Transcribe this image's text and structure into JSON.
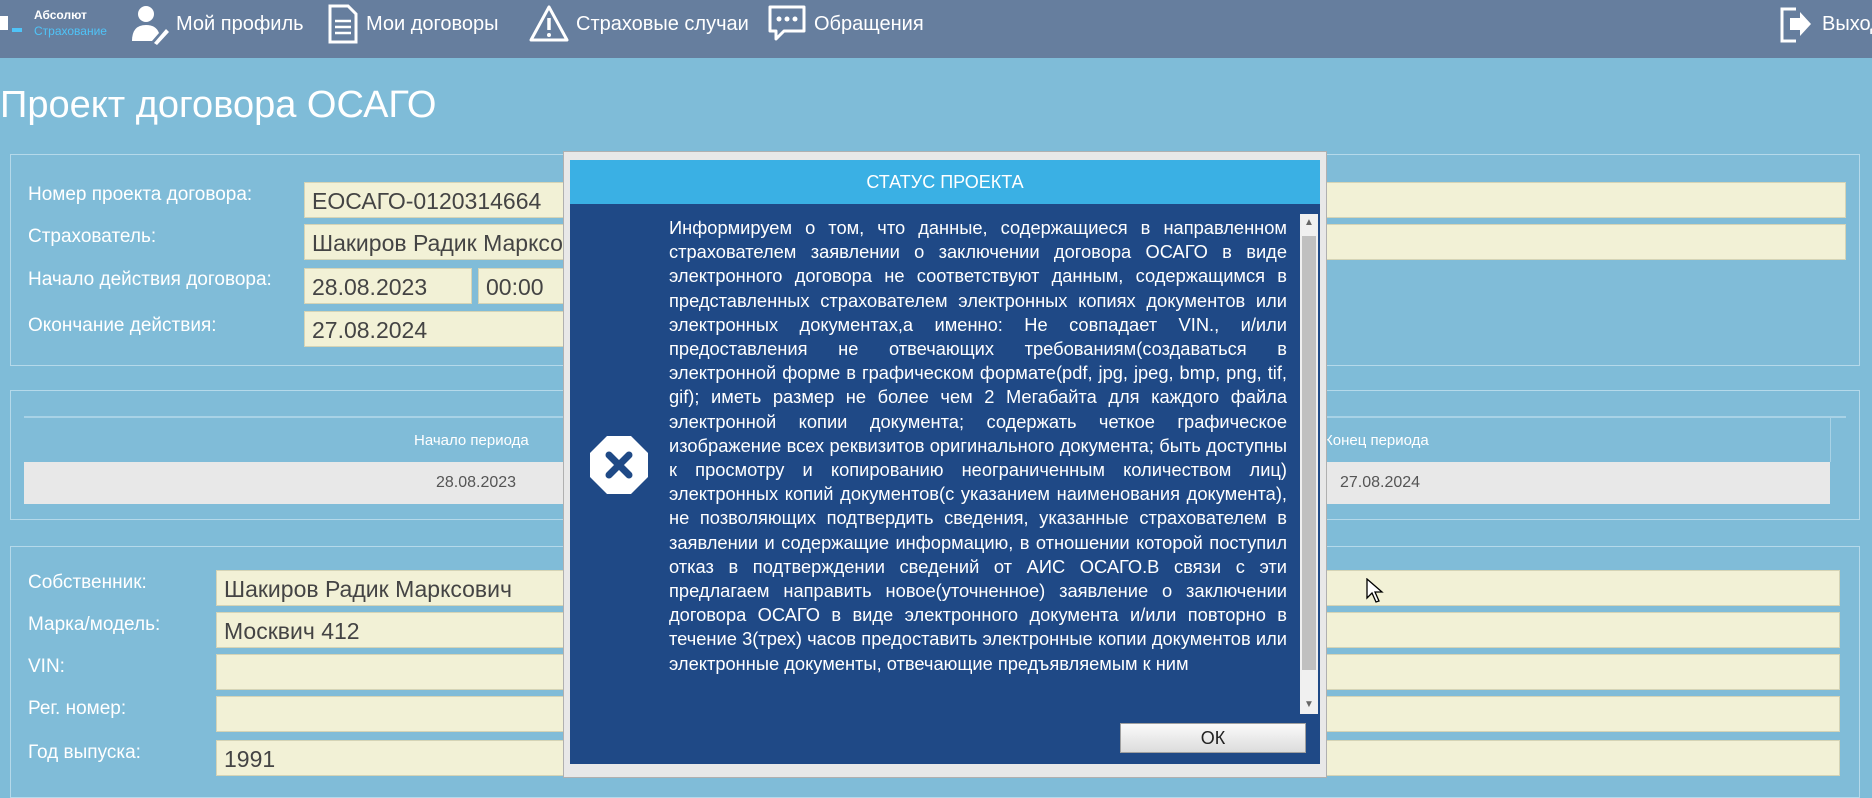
{
  "nav": {
    "logo_line1": "Абсолют",
    "logo_line2": "Страхование",
    "profile": "Мой профиль",
    "contracts": "Мои договоры",
    "insured_events": "Страховые случаи",
    "appeals": "Обращения",
    "exit": "Выход"
  },
  "page_title": "Проект договора ОСАГО",
  "contract": {
    "number_label": "Номер проекта договора:",
    "number_value": "ЕОСАГО-0120314664",
    "insurer_label": "Страхователь:",
    "insurer_value": "Шакиров Радик Марксович",
    "start_label": "Начало действия договора:",
    "start_date": "28.08.2023",
    "start_time": "00:00",
    "end_label": "Окончание действия:",
    "end_date": "27.08.2024"
  },
  "period_table": {
    "headers": [
      "Начало периода",
      "Конец периода"
    ],
    "rows": [
      [
        "28.08.2023",
        "27.08.2024"
      ]
    ]
  },
  "vehicle": {
    "owner_label": "Собственник:",
    "owner_value": "Шакиров Радик Марксович",
    "model_label": "Марка/модель:",
    "model_value": "Москвич 412",
    "vin_label": "VIN:",
    "vin_value": "",
    "reg_label": "Рег. номер:",
    "reg_value": "",
    "year_label": "Год выпуска:",
    "year_value": "1991"
  },
  "modal": {
    "title": "СТАТУС ПРОЕКТА",
    "message": "Информируем о том, что данные, содержащиеся в направленном страхователем заявлении о заключении договора ОСАГО в виде электронного договора не соответствуют данным, содержащимся в представленных страхователем электронных копиях документов или электронных документах,а именно: Не совпадает VIN., и/или предоставления не отвечающих требованиям(создаваться в электронной форме в графическом формате(pdf, jpg, jpeg, bmp, png, tif, gif); иметь размер не более чем 2 Мегабайта для каждого файла электронной копии документа; содержать четкое графическое изображение всех реквизитов оригинального документа; быть доступны к просмотру и копированию неограниченным количеством лиц) электронных копий документов(с указанием наименования документа), не позволяющих подтвердить сведения, указанные страхователем в заявлении и содержащие информацию, в отношении которой поступил отказ в подтверждении сведений от АИС ОСАГО.В связи с эти предлагаем направить новое(уточненное) заявление о заключении договора ОСАГО в виде электронного документа и/или повторно в течение 3(трех) часов предоставить электронные копии документов или электронные документы, отвечающие предъявляемым к ним",
    "ok_label": "ОК"
  },
  "colors": {
    "background": "#7fbcd8",
    "topbar": "#667e9e",
    "field": "#f2f1d6",
    "modal_body": "#1f4986",
    "modal_header": "#3ab0e4"
  }
}
